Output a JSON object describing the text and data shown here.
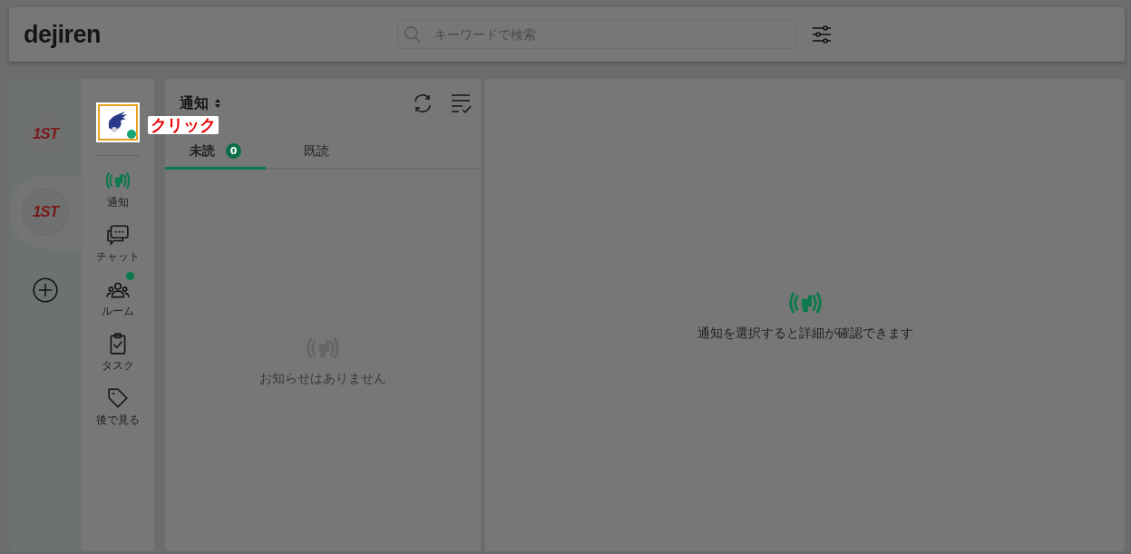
{
  "header": {
    "logo": "dejiren",
    "search": {
      "placeholder": "キーワードで検索"
    }
  },
  "workspaces": [
    {
      "label": "1ST",
      "selected": false
    },
    {
      "label": "1ST",
      "selected": true
    }
  ],
  "user": {
    "online": true,
    "annotation": "クリック"
  },
  "nav": [
    {
      "label": "通知",
      "selected": true,
      "badge": false
    },
    {
      "label": "チャット",
      "selected": false,
      "badge": false
    },
    {
      "label": "ルーム",
      "selected": false,
      "badge": true
    },
    {
      "label": "タスク",
      "selected": false,
      "badge": false
    },
    {
      "label": "後で見る",
      "selected": false,
      "badge": false
    }
  ],
  "list_panel": {
    "title": "通知",
    "tabs": [
      {
        "label": "未読",
        "count": "0",
        "selected": true
      },
      {
        "label": "既読",
        "selected": false
      }
    ],
    "empty_message": "お知らせはありません"
  },
  "detail_panel": {
    "message": "通知を選択すると詳細が確認できます"
  }
}
